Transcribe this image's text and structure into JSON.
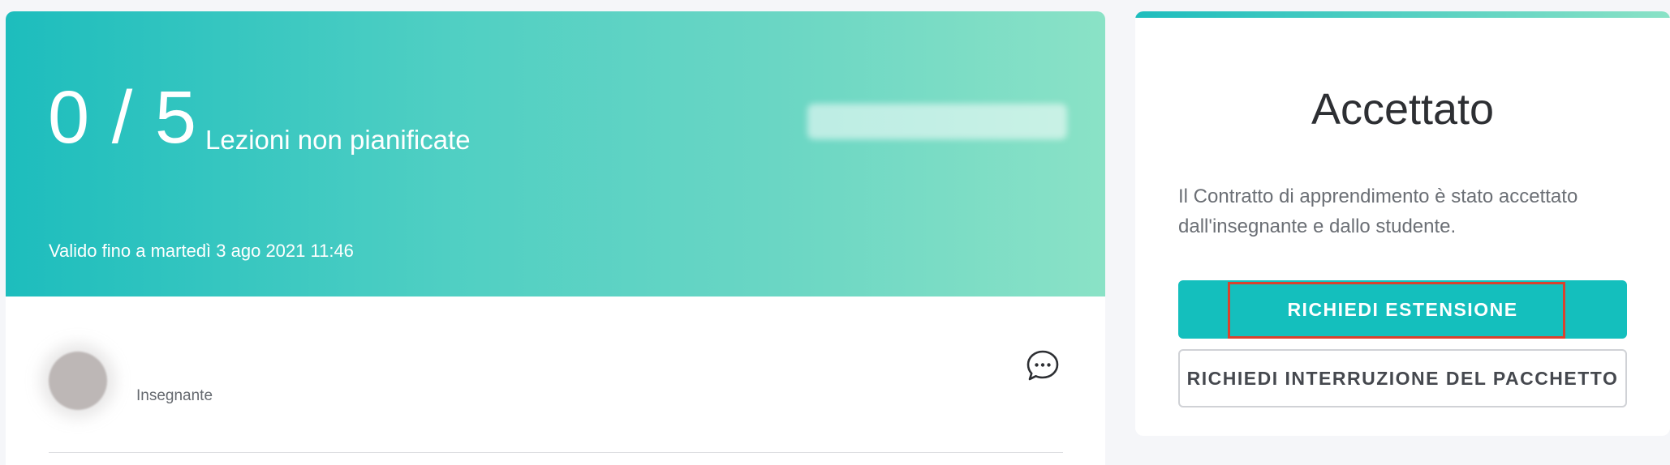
{
  "package": {
    "used": "0",
    "separator": "/",
    "total": "5",
    "label": "Lezioni non pianificate",
    "validity_prefix": "Valido fino a ",
    "validity_date": "martedì 3 ago 2021 11:46"
  },
  "teacher": {
    "role": "Insegnante"
  },
  "status": {
    "title": "Accettato",
    "description": "Il Contratto di apprendimento è stato accettato dall'insegnante e dallo studente."
  },
  "actions": {
    "request_extension": "RICHIEDI ESTENSIONE",
    "request_interruption": "RICHIEDI INTERRUZIONE DEL PACCHETTO"
  },
  "colors": {
    "accent": "#14bfbd",
    "highlight": "#d9422e"
  },
  "icons": {
    "chat": "chat-bubble-icon"
  }
}
